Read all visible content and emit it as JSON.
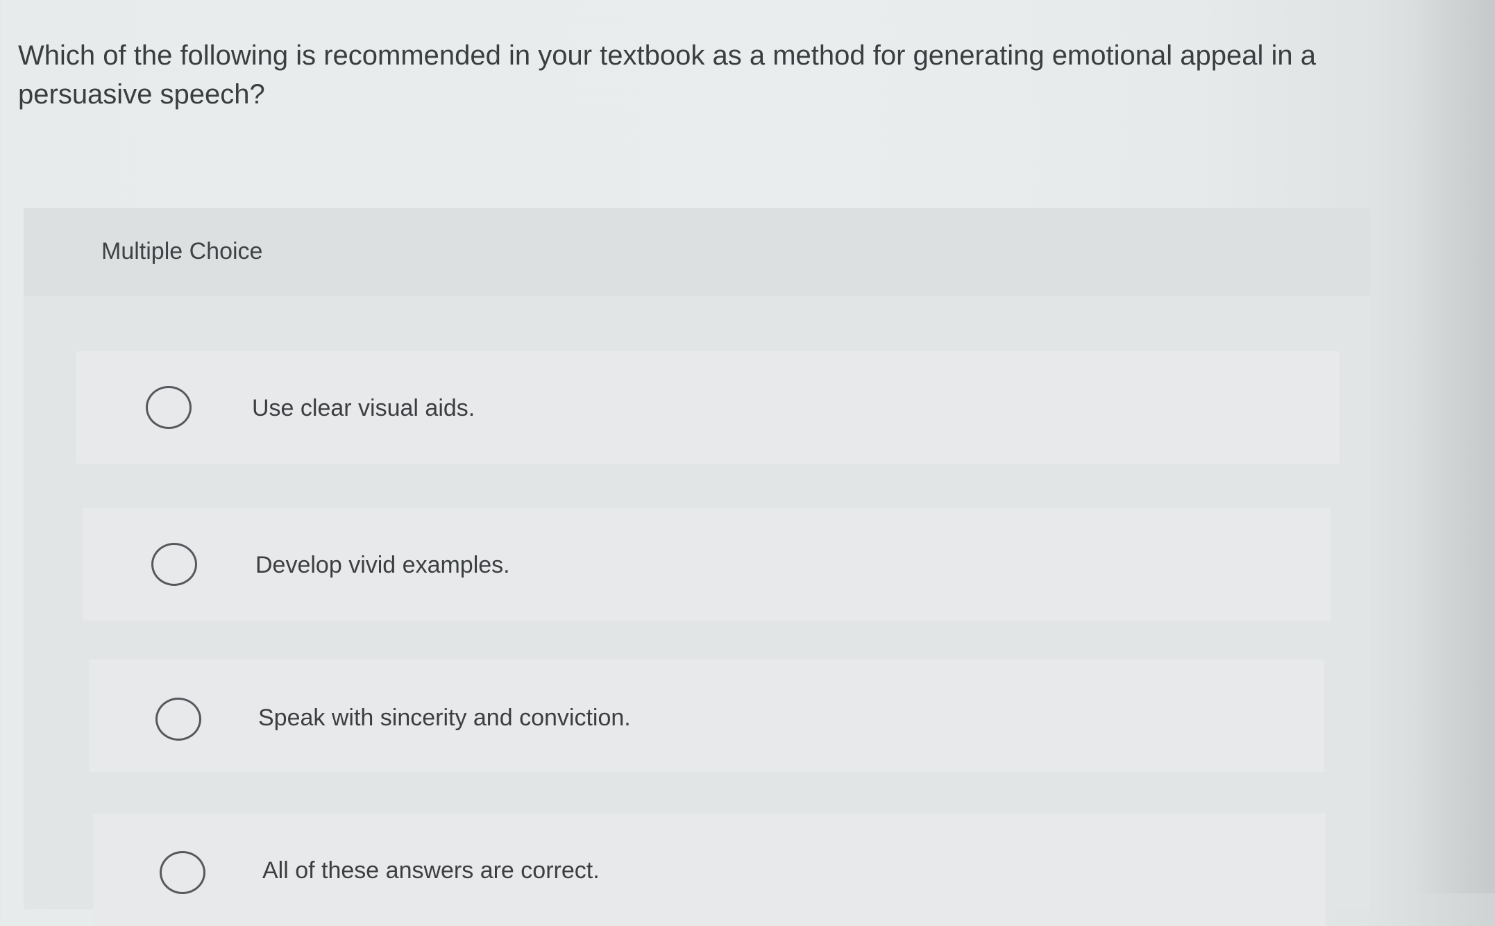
{
  "question": {
    "text": "Which of the following is recommended in your textbook as a method for generating emotional appeal in a persuasive speech?"
  },
  "panel": {
    "title": "Multiple Choice"
  },
  "options": [
    {
      "label": "Use clear visual aids.",
      "selected": false
    },
    {
      "label": "Develop vivid examples.",
      "selected": false
    },
    {
      "label": "Speak with sincerity and conviction.",
      "selected": false
    },
    {
      "label": "All of these answers are correct.",
      "selected": false
    }
  ]
}
